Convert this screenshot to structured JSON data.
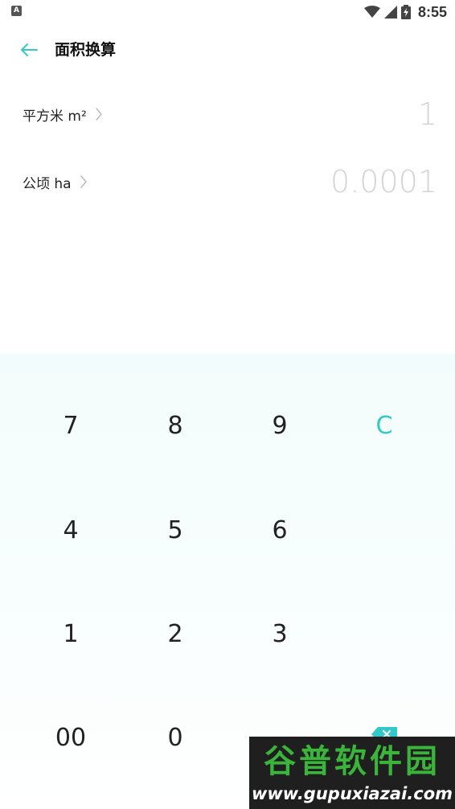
{
  "status_bar": {
    "app_icon_letter": "A",
    "time": "8:55",
    "icons": [
      "wifi-icon",
      "signal-icon",
      "battery-charging-icon"
    ]
  },
  "header": {
    "back_icon": "arrow-left-icon",
    "title": "面积换算"
  },
  "units": [
    {
      "label": "平方米 m²",
      "value": "1"
    },
    {
      "label": "公顷 ha",
      "value": "0.0001"
    }
  ],
  "keypad": {
    "keys": {
      "seven": "7",
      "eight": "8",
      "nine": "9",
      "clear": "C",
      "four": "4",
      "five": "5",
      "six": "6",
      "one": "1",
      "two": "2",
      "three": "3",
      "double_zero": "00",
      "zero": "0",
      "backspace_icon": "backspace-icon"
    }
  },
  "watermark": {
    "title": "谷普软件园",
    "url": "www.gupuxiazai.com"
  },
  "colors": {
    "accent": "#33c9c9",
    "value_text": "#d4d4d4",
    "keypad_bg": "#f3fcfc"
  }
}
